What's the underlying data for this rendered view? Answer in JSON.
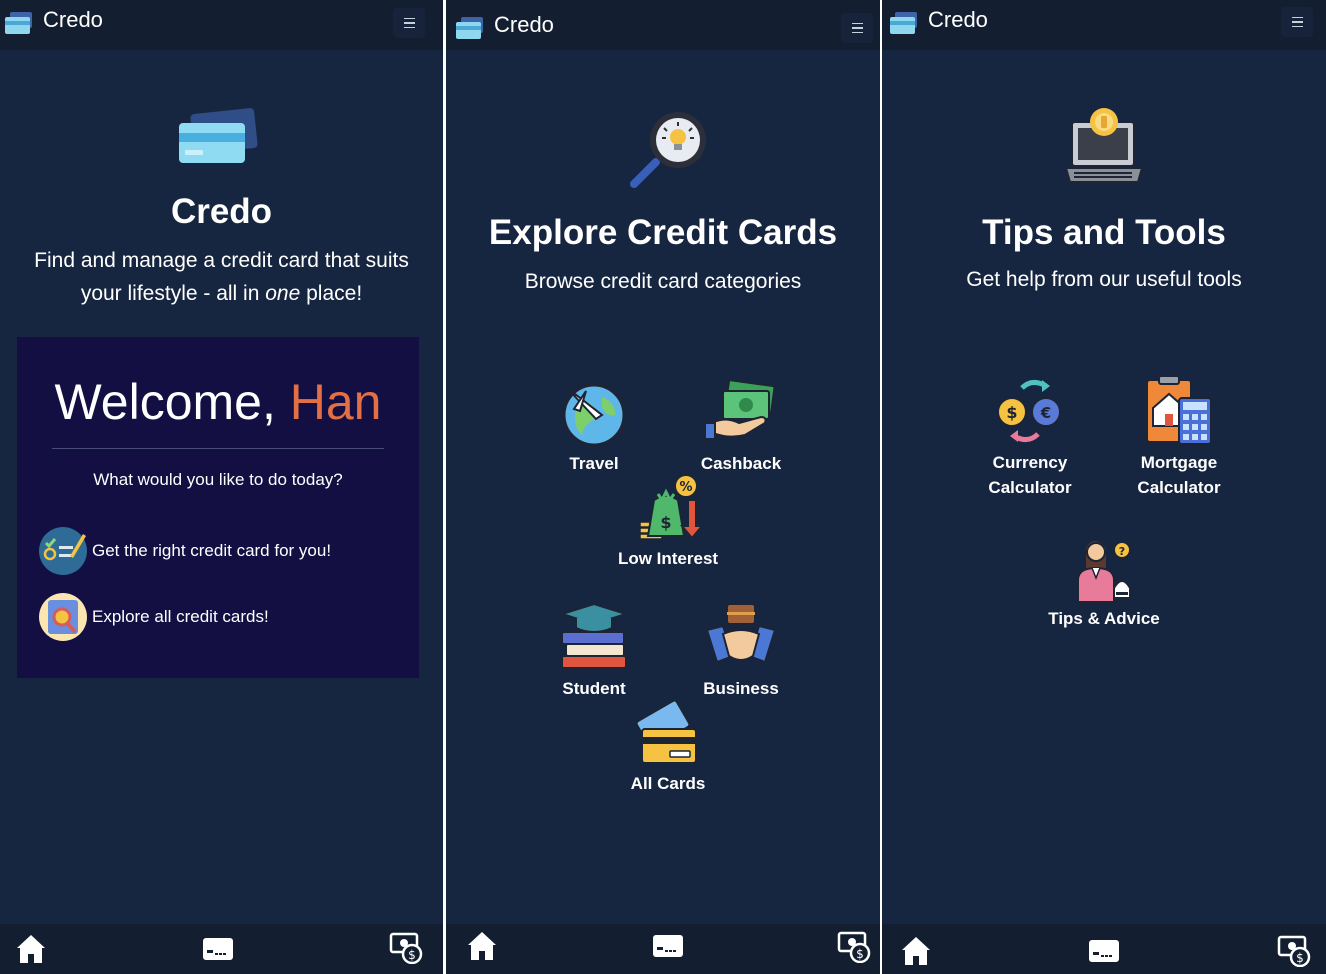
{
  "app": {
    "brand": "Credo"
  },
  "home": {
    "title": "Credo",
    "tagline_prefix": "Find and manage a credit card that suits your lifestyle - all in ",
    "tagline_emphasis": "one",
    "tagline_suffix": " place!",
    "welcome_prefix": "Welcome, ",
    "welcome_name": "Han",
    "question": "What would you like to do today?",
    "actions": [
      {
        "label": "Get the right credit card for you!",
        "icon": "checklist-pen-icon"
      },
      {
        "label": "Explore all credit cards!",
        "icon": "card-search-icon"
      }
    ]
  },
  "explore": {
    "title": "Explore Credit Cards",
    "subtitle": "Browse credit card categories",
    "categories": [
      {
        "label": "Travel",
        "icon": "globe-plane-icon"
      },
      {
        "label": "Cashback",
        "icon": "cash-hand-icon"
      },
      {
        "label": "Low Interest",
        "icon": "money-percent-icon"
      },
      {
        "label": "Student",
        "icon": "graduation-books-icon"
      },
      {
        "label": "Business",
        "icon": "handshake-briefcase-icon"
      },
      {
        "label": "All Cards",
        "icon": "credit-cards-icon"
      }
    ]
  },
  "tools": {
    "title": "Tips and Tools",
    "subtitle": "Get help from our useful tools",
    "items": [
      {
        "label": "Currency Calculator",
        "icon": "currency-exchange-icon"
      },
      {
        "label": "Mortgage Calculator",
        "icon": "house-calculator-icon"
      },
      {
        "label": "Tips & Advice",
        "icon": "advisor-icon"
      }
    ]
  },
  "bottom_nav": [
    {
      "icon": "home-icon"
    },
    {
      "icon": "card-icon"
    },
    {
      "icon": "money-exchange-icon"
    }
  ],
  "colors": {
    "background": "#172640",
    "bar": "#131f30",
    "panel": "#130f42",
    "accent": "#e36f44"
  }
}
